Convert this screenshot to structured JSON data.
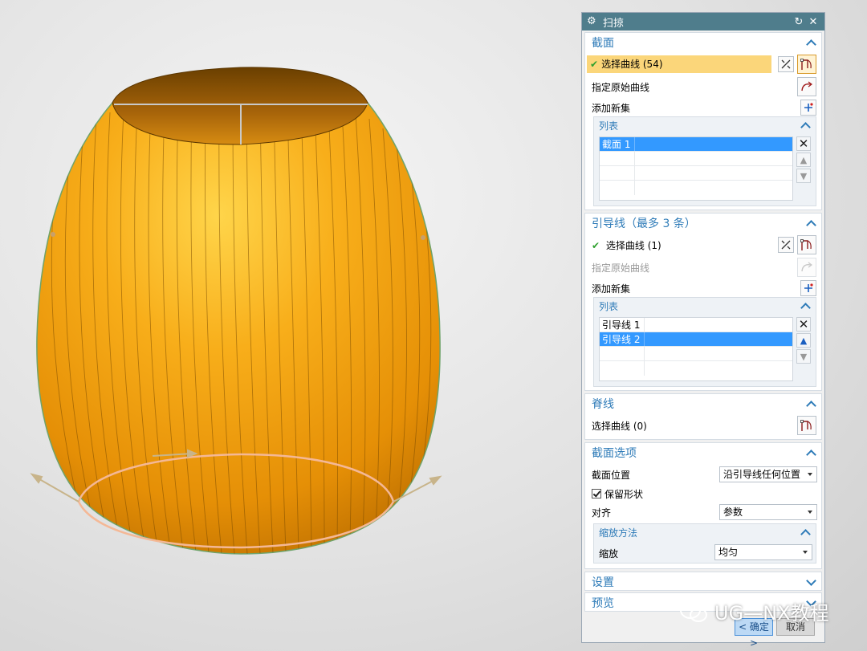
{
  "dialog": {
    "title": "扫掠",
    "section": {
      "header": "截面",
      "select_curve": "选择曲线 (54)",
      "specify_origin": "指定原始曲线",
      "add_new_set": "添加新集",
      "list_header": "列表",
      "rows": [
        "截面 1"
      ]
    },
    "guide": {
      "header": "引导线（最多 3 条）",
      "select_curve": "选择曲线 (1)",
      "specify_origin": "指定原始曲线",
      "add_new_set": "添加新集",
      "list_header": "列表",
      "rows": [
        "引导线 1",
        "引导线 2"
      ]
    },
    "spine": {
      "header": "脊线",
      "select_curve": "选择曲线 (0)"
    },
    "section_options": {
      "header": "截面选项",
      "position_label": "截面位置",
      "position_value": "沿引导线任何位置",
      "preserve_shape": "保留形状",
      "preserve_checked": true,
      "align_label": "对齐",
      "align_value": "参数",
      "scaling": {
        "header": "缩放方法",
        "label": "缩放",
        "value": "均匀"
      }
    },
    "settings_header": "设置",
    "preview_header": "预览",
    "ok_label": "< 确定 >",
    "cancel_label": "取消"
  },
  "watermark": "UG—NX教程",
  "colors": {
    "title_bar": "#4f7d8c",
    "section_header": "#2e7bb8",
    "highlight": "#fbd67a",
    "selection": "#3399ff",
    "model_orange": "#f5a20f",
    "curve": "#f2b48a"
  }
}
